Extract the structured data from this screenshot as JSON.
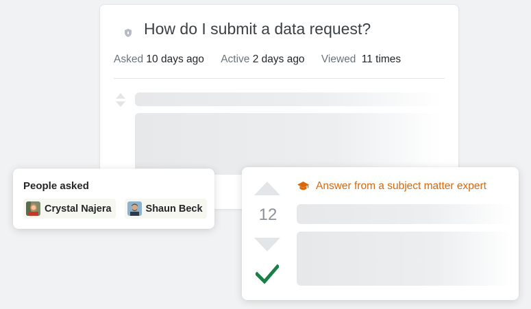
{
  "question": {
    "title": "How do I submit a data request?",
    "lock_icon": "lock-icon",
    "asked_label": "Asked",
    "asked_value": "10 days ago",
    "active_label": "Active",
    "active_value": "2 days ago",
    "viewed_label": "Viewed",
    "viewed_value": "11 times"
  },
  "people_asked": {
    "title": "People asked",
    "people": [
      {
        "name": "Crystal Najera",
        "avatar": "avatar-crystal"
      },
      {
        "name": "Shaun Beck",
        "avatar": "avatar-shaun"
      }
    ]
  },
  "answer": {
    "vote_count": "12",
    "expert_label": "Answer from a subject matter expert",
    "accepted": true,
    "colors": {
      "accent": "#da670b",
      "accepted": "#1a7f47",
      "arrow": "#e3e6e8"
    }
  }
}
